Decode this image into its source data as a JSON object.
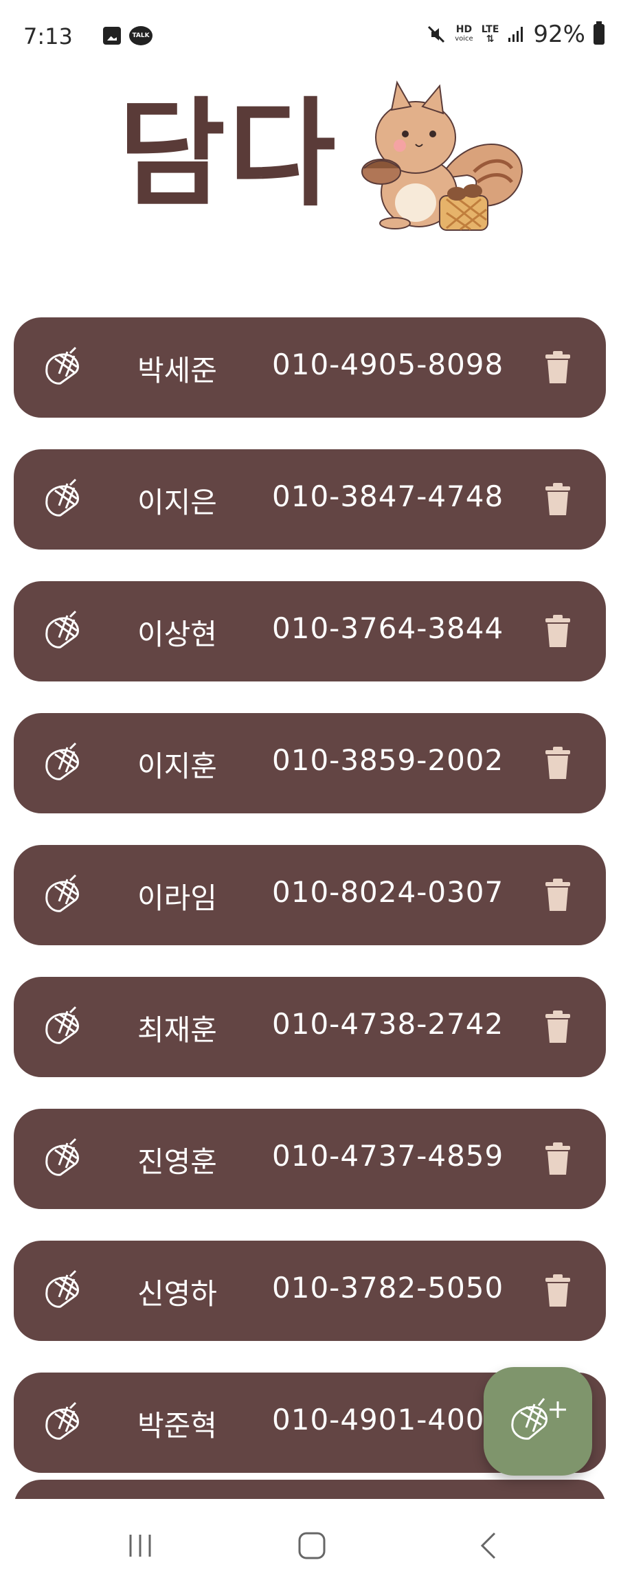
{
  "status_bar": {
    "time": "7:13",
    "hd_label": "HD",
    "voice_label": "voice",
    "lte_label": "LTE",
    "battery_percent": "92%",
    "talk_label": "TALK"
  },
  "header": {
    "title": "담다",
    "mascot": "squirrel-illustration"
  },
  "contacts": [
    {
      "name": "박세준",
      "phone": "010-4905-8098"
    },
    {
      "name": "이지은",
      "phone": "010-3847-4748"
    },
    {
      "name": "이상현",
      "phone": "010-3764-3844"
    },
    {
      "name": "이지훈",
      "phone": "010-3859-2002"
    },
    {
      "name": "이라임",
      "phone": "010-8024-0307"
    },
    {
      "name": "최재훈",
      "phone": "010-4738-2742"
    },
    {
      "name": "진영훈",
      "phone": "010-4737-4859"
    },
    {
      "name": "신영하",
      "phone": "010-3782-5050"
    },
    {
      "name": "박준혁",
      "phone": "010-4901-4003"
    }
  ],
  "colors": {
    "row_bg": "#634544",
    "title": "#5a3b38",
    "fab_bg": "#7f956c",
    "delete_icon": "#e9d3c5"
  },
  "icons": {
    "row_icon": "acorn-icon",
    "delete_icon": "trash-icon",
    "fab_icon": "add-acorn-icon"
  }
}
